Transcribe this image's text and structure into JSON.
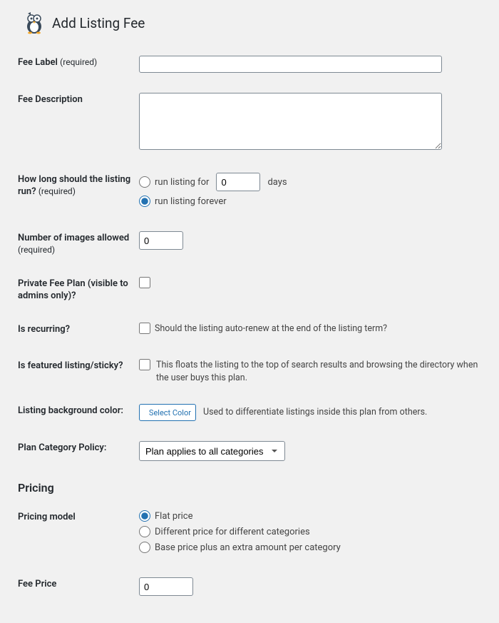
{
  "header": {
    "title": "Add Listing Fee"
  },
  "fields": {
    "feeLabel": {
      "label": "Fee Label",
      "req": "(required)"
    },
    "feeDescription": {
      "label": "Fee Description"
    },
    "duration": {
      "label": "How long should the listing run?",
      "req": "(required)",
      "optFor": "run listing for",
      "days": "0",
      "daysSuffix": "days",
      "optForever": "run listing forever"
    },
    "images": {
      "label": "Number of images allowed",
      "req": "(required)",
      "value": "0"
    },
    "private": {
      "label": "Private Fee Plan (visible to admins only)?"
    },
    "recurring": {
      "label": "Is recurring?",
      "desc": "Should the listing auto-renew at the end of the listing term?"
    },
    "featured": {
      "label": "Is featured listing/sticky?",
      "desc": "This floats the listing to the top of search results and browsing the directory when the user buys this plan."
    },
    "bgcolor": {
      "label": "Listing background color:",
      "button": "Select Color",
      "desc": "Used to differentiate listings inside this plan from others."
    },
    "policy": {
      "label": "Plan Category Policy:",
      "selected": "Plan applies to all categories"
    }
  },
  "pricing": {
    "heading": "Pricing",
    "model": {
      "label": "Pricing model",
      "optFlat": "Flat price",
      "optDiff": "Different price for different categories",
      "optBase": "Base price plus an extra amount per category"
    },
    "fee": {
      "label": "Fee Price",
      "value": "0"
    }
  }
}
